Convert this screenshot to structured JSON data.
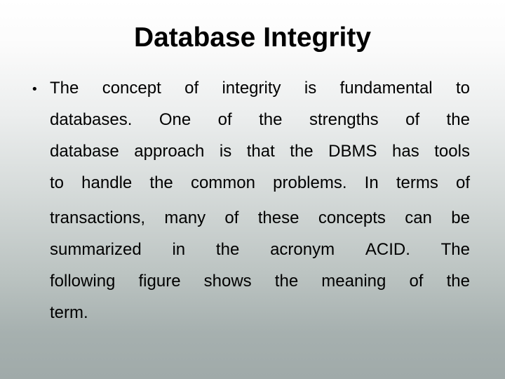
{
  "slide": {
    "title": "Database Integrity",
    "bullet_glyph": "•",
    "body_text": "The concept of integrity is fundamental to databases.  One of the strengths of the database approach is that the DBMS has tools to handle the common problems.  In terms of transactions, many of these concepts can be summarized in the acronym ACID. The following figure shows the meaning of the term.",
    "lines": [
      "The concept of integrity is fundamental to",
      "databases.  One of the strengths of the",
      "database approach is that the DBMS has tools",
      "to handle the common problems.  In terms of",
      "transactions, many of these concepts can be",
      "summarized in the acronym ACID. The",
      "following figure shows the meaning of the",
      "term."
    ]
  },
  "colors": {
    "background_top": "#ffffff",
    "background_bottom": "#a0aaa9",
    "text": "#000000"
  }
}
